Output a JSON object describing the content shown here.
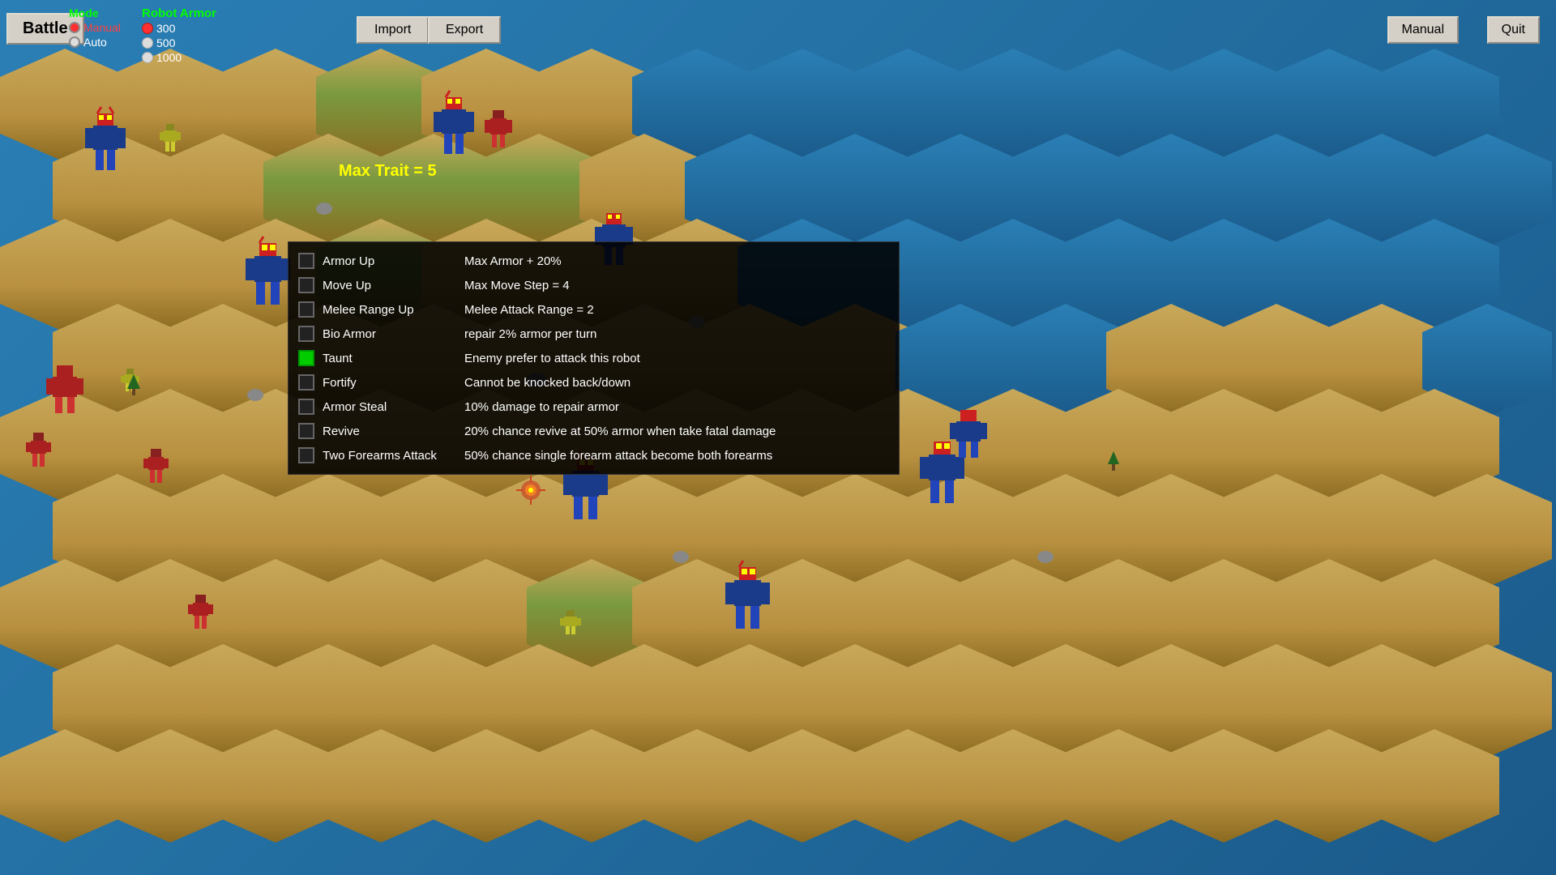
{
  "buttons": {
    "battle": "Battle",
    "import": "Import",
    "export": "Export",
    "manual": "Manual",
    "quit": "Quit"
  },
  "mode": {
    "label": "Mode",
    "options": [
      {
        "label": "Manual",
        "active": true,
        "color": "red"
      },
      {
        "label": "Auto",
        "active": false,
        "color": "white"
      }
    ]
  },
  "robotArmor": {
    "label": "Robot Armor",
    "values": [
      {
        "value": "300",
        "active": true
      },
      {
        "value": "500",
        "active": false
      },
      {
        "value": "1000",
        "active": false
      }
    ]
  },
  "maxTrait": "Max Trait = 5",
  "traits": [
    {
      "id": "armor-up",
      "name": "Armor Up",
      "desc": "Max Armor + 20%",
      "checked": false
    },
    {
      "id": "move-up",
      "name": "Move Up",
      "desc": "Max Move Step = 4",
      "checked": false
    },
    {
      "id": "melee-range-up",
      "name": "Melee Range Up",
      "desc": "Melee Attack Range = 2",
      "checked": false
    },
    {
      "id": "bio-armor",
      "name": "Bio Armor",
      "desc": "repair 2% armor per turn",
      "checked": false
    },
    {
      "id": "taunt",
      "name": "Taunt",
      "desc": "Enemy prefer to attack this robot",
      "checked": true
    },
    {
      "id": "fortify",
      "name": "Fortify",
      "desc": "Cannot be knocked back/down",
      "checked": false
    },
    {
      "id": "armor-steal",
      "name": "Armor Steal",
      "desc": "10% damage to repair armor",
      "checked": false
    },
    {
      "id": "revive",
      "name": "Revive",
      "desc": "20% chance revive at 50% armor when take fatal damage",
      "checked": false
    },
    {
      "id": "two-forearms",
      "name": "Two Forearms Attack",
      "desc": "50% chance single forearm attack become both forearms",
      "checked": false
    }
  ]
}
